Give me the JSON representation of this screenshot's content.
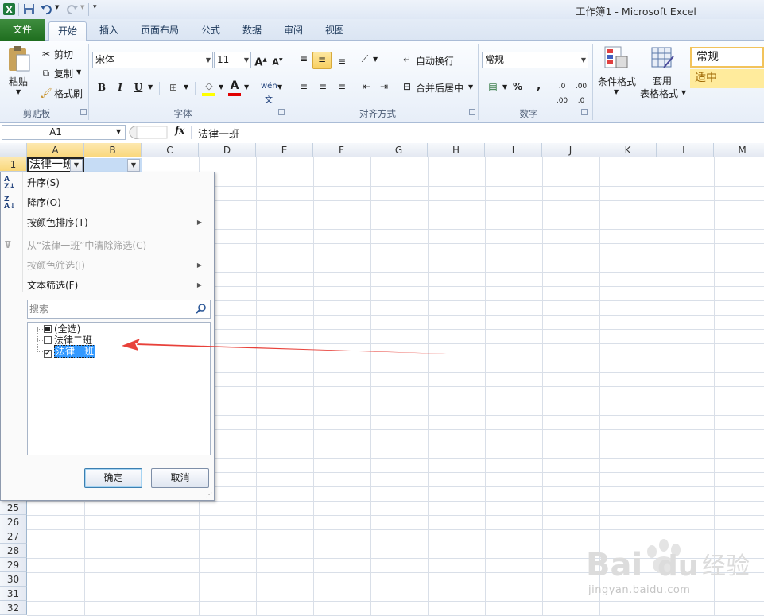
{
  "window": {
    "title": "工作簿1 - Microsoft Excel"
  },
  "ribbon_tabs": [
    {
      "label": "文件"
    },
    {
      "label": "开始"
    },
    {
      "label": "插入"
    },
    {
      "label": "页面布局"
    },
    {
      "label": "公式"
    },
    {
      "label": "数据"
    },
    {
      "label": "审阅"
    },
    {
      "label": "视图"
    }
  ],
  "clipboard": {
    "paste": "粘贴",
    "cut": "剪切",
    "copy": "复制",
    "format_painter": "格式刷",
    "group": "剪贴板"
  },
  "font": {
    "name": "宋体",
    "size": "11",
    "group": "字体"
  },
  "alignment": {
    "wrap": "自动换行",
    "merge": "合并后居中",
    "group": "对齐方式"
  },
  "number": {
    "format": "常规",
    "percent": "%",
    "comma": ",",
    "group": "数字"
  },
  "styles": {
    "conditional": "条件格式",
    "table_line1": "套用",
    "table_line2": "表格格式",
    "cell_normal": "常规",
    "cell_neutral": "适中"
  },
  "formula_bar": {
    "cell_ref": "A1",
    "fx": "fx",
    "value": "法律一班"
  },
  "columns": [
    "A",
    "B",
    "C",
    "D",
    "E",
    "F",
    "G",
    "H",
    "I",
    "J",
    "K",
    "L",
    "M"
  ],
  "rows_top": [
    "1"
  ],
  "rows_bottom": [
    "25",
    "26",
    "27",
    "28",
    "29",
    "30",
    "31",
    "32"
  ],
  "cells": {
    "a1": "法律一班"
  },
  "filter_menu": {
    "sort_asc": "升序(S)",
    "sort_desc": "降序(O)",
    "sort_color": "按颜色排序(T)",
    "clear_filter": "从“法律一班”中清除筛选(C)",
    "filter_color": "按颜色筛选(I)",
    "text_filter": "文本筛选(F)",
    "search_placeholder": "搜索",
    "items": [
      {
        "label": "(全选)",
        "state": "mixed"
      },
      {
        "label": "法律二班",
        "state": "unchecked"
      },
      {
        "label": "法律一班",
        "state": "checked"
      }
    ],
    "ok": "确定",
    "cancel": "取消"
  },
  "annotation": {
    "arrow_color": "#e8413a"
  },
  "watermark": {
    "brand": "Bai du 经验",
    "url": "jingyan.baidu.com"
  }
}
